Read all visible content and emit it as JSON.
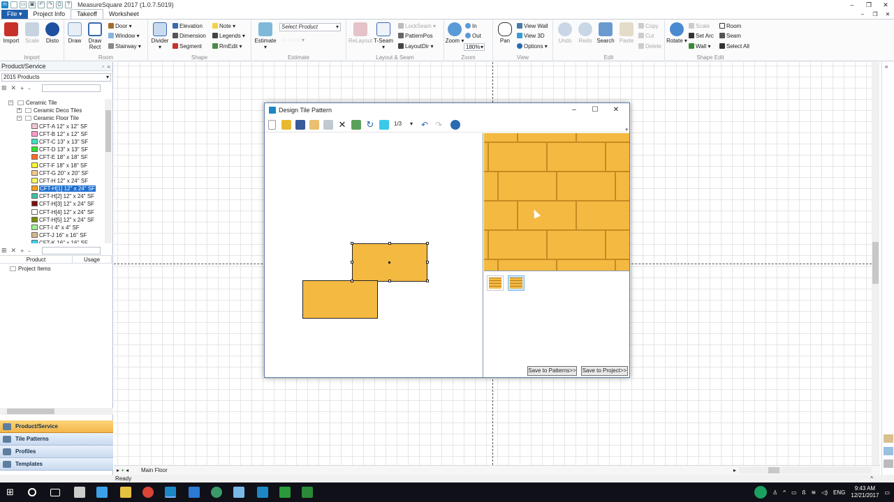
{
  "app": {
    "title": "MeasureSquare 2017 (1.0.7.5019)"
  },
  "menu": {
    "file": "File",
    "tabs": [
      "Project Info",
      "Takeoff",
      "Worksheet"
    ]
  },
  "ribbon": {
    "import": {
      "label": "Import",
      "buttons": [
        "Import",
        "Scale",
        "Disto"
      ]
    },
    "room": {
      "label": "Room",
      "draw": "Draw",
      "draw_rect": "Draw Rect",
      "door": "Door",
      "window": "Window",
      "stairway": "Stairway"
    },
    "shape": {
      "label": "Shape",
      "divider": "Divider",
      "elevation": "Elevation",
      "dimension": "Dimension",
      "segment": "Segment",
      "note": "Note",
      "legends": "Legends",
      "rmedit": "RmEdit"
    },
    "estimate": {
      "label": "Estimate",
      "estimate": "Estimate",
      "select_product": "Select Product"
    },
    "layout_seam": {
      "label": "Layout & Seam",
      "relayout": "ReLayout",
      "tseam": "T-Seam",
      "lockseam": "LockSeam",
      "patternpos": "PatternPos",
      "layoutdir": "LayoutDir"
    },
    "zoom": {
      "label": "Zoom",
      "zoom": "Zoom",
      "in": "In",
      "out": "Out",
      "level": "180%"
    },
    "view": {
      "label": "View",
      "pan": "Pan",
      "view_wall": "View Wall",
      "view_3d": "View 3D",
      "options": "Options"
    },
    "edit": {
      "label": "Edit",
      "undo": "Undo",
      "redo": "Redo",
      "search": "Search",
      "paste": "Paste",
      "copy": "Copy",
      "cut": "Cut",
      "delete": "Delete"
    },
    "shape_edit": {
      "label": "Shape Edit",
      "rotate": "Rotate",
      "scale": "Scale",
      "set_arc": "Set Arc",
      "wall": "Wall",
      "room": "Room",
      "seam": "Seam",
      "select_all": "Select All"
    }
  },
  "left_panel": {
    "title": "Product/Service",
    "product_set": "2015 Products",
    "tree": [
      {
        "label": "Ceramic Tile",
        "level": 0,
        "color": ""
      },
      {
        "label": "Ceramic Deco Tiles",
        "level": 1,
        "color": ""
      },
      {
        "label": "Ceramic Floor Tile",
        "level": 1,
        "color": ""
      },
      {
        "label": "CFT-A 12\" x 12\" SF",
        "level": 2,
        "color": "#f2c9d8"
      },
      {
        "label": "CFT-B 12\" x 12\" SF",
        "level": 2,
        "color": "#ff9cc8"
      },
      {
        "label": "CFT-C 13\" x 13\" SF",
        "level": 2,
        "color": "#40e0c0"
      },
      {
        "label": "CFT-D 13\" x 13\" SF",
        "level": 2,
        "color": "#30e030"
      },
      {
        "label": "CFT-E 18\" x 18\" SF",
        "level": 2,
        "color": "#ff6a20"
      },
      {
        "label": "CFT-F 18\" x 18\" SF",
        "level": 2,
        "color": "#ffff30"
      },
      {
        "label": "CFT-G 20\" x 20\" SF",
        "level": 2,
        "color": "#f5c888"
      },
      {
        "label": "CFT-H 12\" x 24\" SF",
        "level": 2,
        "color": "#ffff60"
      },
      {
        "label": "CFT-H[1] 12\" x 24\" SF",
        "level": 2,
        "color": "#f4a020",
        "selected": true
      },
      {
        "label": "CFT-H[2] 12\" x 24\" SF",
        "level": 2,
        "color": "#40c0a0"
      },
      {
        "label": "CFT-H[3] 12\" x 24\" SF",
        "level": 2,
        "color": "#7a1010"
      },
      {
        "label": "CFT-H[4] 12\" x 24\" SF",
        "level": 2,
        "color": "#ffffff"
      },
      {
        "label": "CFT-H[5] 12\" x 24\" SF",
        "level": 2,
        "color": "#7a8a10"
      },
      {
        "label": "CFT-I 4\" x 4\" SF",
        "level": 2,
        "color": "#a0f090"
      },
      {
        "label": "CFT-J 16\" x 16\" SF",
        "level": 2,
        "color": "#d8b890"
      },
      {
        "label": "CFT-K 16\" x 16\" SF",
        "level": 2,
        "color": "#40d0f0"
      }
    ],
    "columns": [
      "Product",
      "Usage"
    ],
    "project_items": "Project Items",
    "nav_tabs": [
      "Product/Service",
      "Tile Patterns",
      "Profiles",
      "Templates"
    ]
  },
  "canvas": {
    "layer": "Main Floor",
    "status": "Ready"
  },
  "dialog": {
    "title": "Design Tile Pattern",
    "page_indicator": "1/3",
    "save_patterns": "Save to Patterns>>",
    "save_project": "Save to Project>>",
    "tile_color": "#f4b941"
  },
  "taskbar": {
    "language": "ENG",
    "time": "9:43 AM",
    "date": "12/21/2017"
  }
}
